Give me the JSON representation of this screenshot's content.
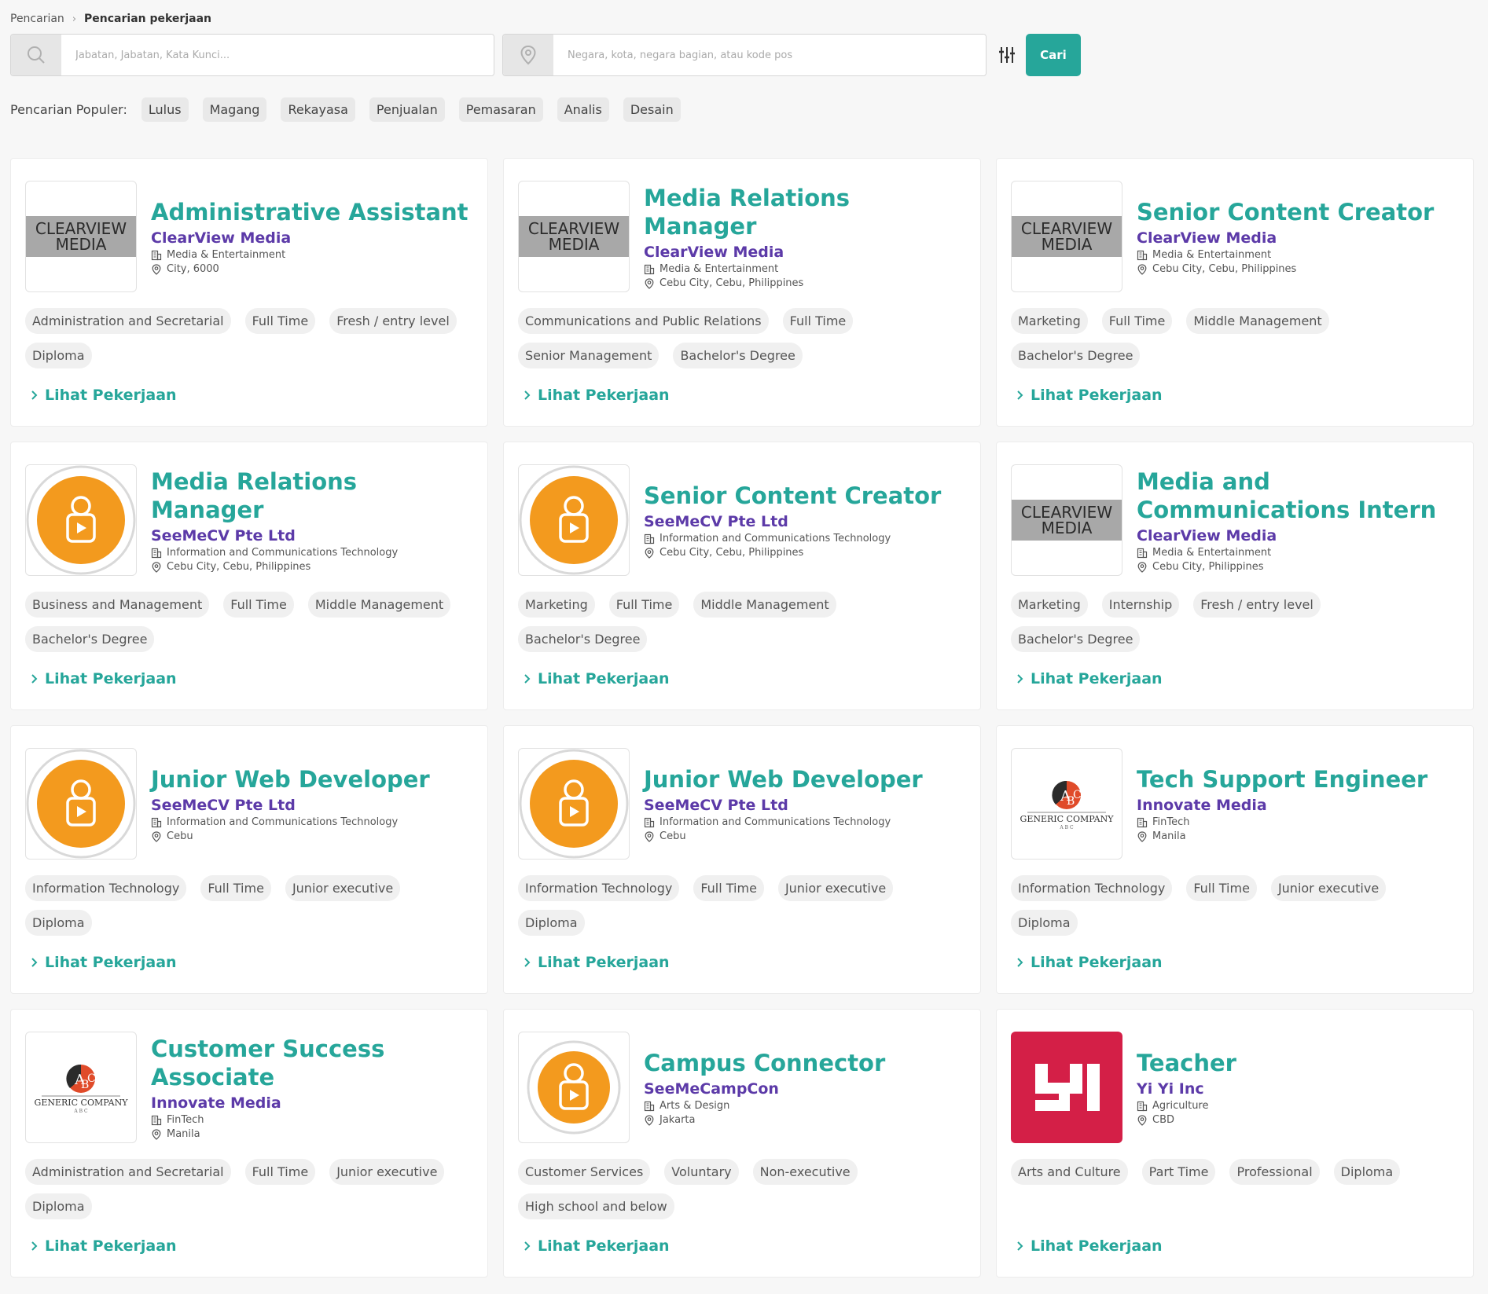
{
  "breadcrumb": {
    "root": "Pencarian",
    "current": "Pencarian pekerjaan"
  },
  "search": {
    "keyword_placeholder": "Jabatan, Jabatan, Kata Kunci...",
    "location_placeholder": "Negara, kota, negara bagian, atau kode pos",
    "submit_label": "Cari"
  },
  "popular": {
    "label": "Pencarian Populer:",
    "items": [
      "Lulus",
      "Magang",
      "Rekayasa",
      "Penjualan",
      "Pemasaran",
      "Analis",
      "Desain"
    ]
  },
  "colors": {
    "accent": "#26a69a",
    "company": "#5c3aa8",
    "orange": "#f39a1e",
    "yi_red": "#d41f47"
  },
  "view_label": "Lihat Pekerjaan",
  "logos": {
    "clearview": [
      "CLEARVIEW",
      "MEDIA"
    ],
    "generic": [
      "GENERIC COMPANY",
      "A B C"
    ],
    "yi": "YI"
  },
  "jobs": [
    {
      "logo": "clearview",
      "title": "Administrative Assistant",
      "company": "ClearView Media",
      "industry": "Media & Entertainment",
      "location": "City, 6000",
      "tags": [
        "Administration and Secretarial",
        "Full Time",
        "Fresh / entry level",
        "Diploma"
      ]
    },
    {
      "logo": "clearview",
      "title": "Media Relations Manager",
      "company": "ClearView Media",
      "industry": "Media & Entertainment",
      "location": "Cebu City, Cebu, Philippines",
      "tags": [
        "Communications and Public Relations",
        "Full Time",
        "Senior Management",
        "Bachelor's Degree"
      ]
    },
    {
      "logo": "clearview",
      "title": "Senior Content Creator",
      "company": "ClearView Media",
      "industry": "Media & Entertainment",
      "location": "Cebu City, Cebu, Philippines",
      "tags": [
        "Marketing",
        "Full Time",
        "Middle Management",
        "Bachelor's Degree"
      ]
    },
    {
      "logo": "seemecv",
      "title": "Media Relations Manager",
      "company": "SeeMeCV Pte Ltd",
      "industry": "Information and Communications Technology",
      "location": "Cebu City, Cebu, Philippines",
      "tags": [
        "Business and Management",
        "Full Time",
        "Middle Management",
        "Bachelor's Degree"
      ]
    },
    {
      "logo": "seemecv",
      "title": "Senior Content Creator",
      "company": "SeeMeCV Pte Ltd",
      "industry": "Information and Communications Technology",
      "location": "Cebu City, Cebu, Philippines",
      "tags": [
        "Marketing",
        "Full Time",
        "Middle Management",
        "Bachelor's Degree"
      ]
    },
    {
      "logo": "clearview",
      "title": "Media and Communications Intern",
      "company": "ClearView Media",
      "industry": "Media & Entertainment",
      "location": "Cebu City, Philippines",
      "tags": [
        "Marketing",
        "Internship",
        "Fresh / entry level",
        "Bachelor's Degree"
      ]
    },
    {
      "logo": "seemecv",
      "title": "Junior Web Developer",
      "company": "SeeMeCV Pte Ltd",
      "industry": "Information and Communications Technology",
      "location": "Cebu",
      "tags": [
        "Information Technology",
        "Full Time",
        "Junior executive",
        "Diploma"
      ]
    },
    {
      "logo": "seemecv",
      "title": "Junior Web Developer",
      "company": "SeeMeCV Pte Ltd",
      "industry": "Information and Communications Technology",
      "location": "Cebu",
      "tags": [
        "Information Technology",
        "Full Time",
        "Junior executive",
        "Diploma"
      ]
    },
    {
      "logo": "generic",
      "title": "Tech Support Engineer",
      "company": "Innovate Media",
      "industry": "FinTech",
      "location": "Manila",
      "tags": [
        "Information Technology",
        "Full Time",
        "Junior executive",
        "Diploma"
      ]
    },
    {
      "logo": "generic",
      "title": "Customer Success Associate",
      "company": "Innovate Media",
      "industry": "FinTech",
      "location": "Manila",
      "tags": [
        "Administration and Secretarial",
        "Full Time",
        "Junior executive",
        "Diploma"
      ]
    },
    {
      "logo": "seemecampcon",
      "title": "Campus Connector",
      "company": "SeeMeCampCon",
      "industry": "Arts & Design",
      "location": "Jakarta",
      "tags": [
        "Customer Services",
        "Voluntary",
        "Non-executive",
        "High school and below"
      ]
    },
    {
      "logo": "yi",
      "title": "Teacher",
      "company": "Yi Yi Inc",
      "industry": "Agriculture",
      "location": "CBD",
      "tags": [
        "Arts and Culture",
        "Part Time",
        "Professional",
        "Diploma"
      ]
    }
  ]
}
